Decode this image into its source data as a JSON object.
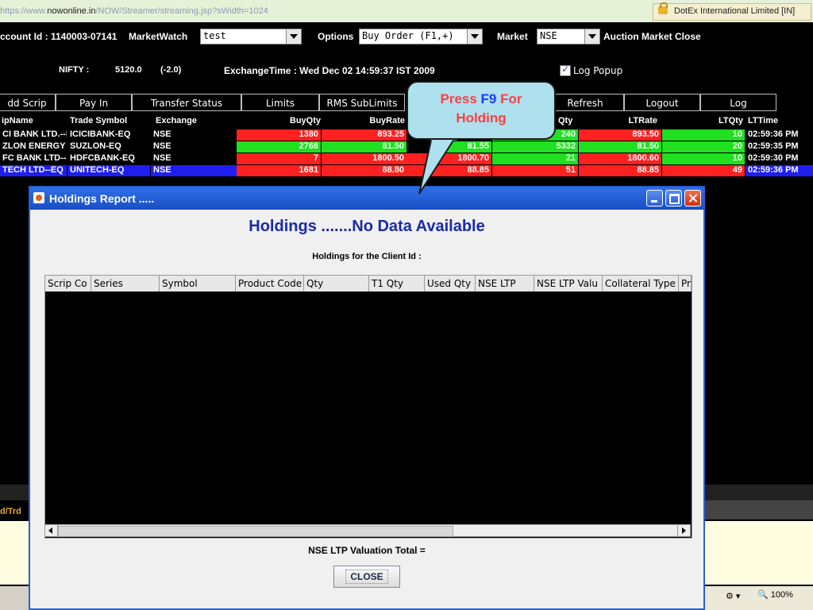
{
  "browser": {
    "url_prefix": "https://www.",
    "url_domain": "nowonline.in",
    "url_path": "/NOW/Streamer/streaming.jsp?sWidth=1024",
    "cert_label": "DotEx International Limited [IN]",
    "zoom_level": "100%"
  },
  "header": {
    "account_label": "ccount Id : 1140003-07141",
    "marketwatch_label": "MarketWatch",
    "marketwatch_value": "test",
    "options_label": "Options",
    "options_value": "Buy Order    (F1,+)",
    "market_label": "Market",
    "market_value": "NSE",
    "auction_label": "Auction Market Close",
    "nifty_label": "NIFTY :",
    "nifty_value": "5120.0",
    "nifty_change": "(-2.0)",
    "exchange_time": "ExchangeTime : Wed Dec 02 14:59:37 IST 2009",
    "log_popup_label": "Log Popup"
  },
  "toolbar": {
    "add_scrip": "dd Scrip",
    "pay_in": "Pay In",
    "transfer_status": "Transfer Status",
    "limits": "Limits",
    "rms_sublimits": "RMS SubLimits",
    "refresh": "Refresh",
    "logout": "Logout",
    "log": "Log"
  },
  "marketwatch": {
    "columns": {
      "scrip_name": "ipName",
      "trade_symbol": "Trade Symbol",
      "exchange": "Exchange",
      "buy_qty": "BuyQty",
      "buy_rate": "BuyRate",
      "qty": "Qty",
      "lt_rate": "LTRate",
      "lt_qty": "LTQty",
      "lt_time": "LTTime"
    },
    "rows": [
      {
        "name": "CI BANK LTD.--E",
        "symbol": "ICICIBANK-EQ",
        "exchange": "NSE",
        "buy_qty": "1380",
        "buy_rate": "893.25",
        "sell_rate": "",
        "sell_qty": "240",
        "lt_rate": "893.50",
        "lt_qty": "10",
        "lt_time": "02:59:36 PM"
      },
      {
        "name": "ZLON ENERGY L",
        "symbol": "SUZLON-EQ",
        "exchange": "NSE",
        "buy_qty": "2768",
        "buy_rate": "81.50",
        "sell_rate": "81.55",
        "sell_qty": "5332",
        "lt_rate": "81.50",
        "lt_qty": "20",
        "lt_time": "02:59:35 PM"
      },
      {
        "name": "FC BANK LTD--E",
        "symbol": "HDFCBANK-EQ",
        "exchange": "NSE",
        "buy_qty": "7",
        "buy_rate": "1800.50",
        "sell_rate": "1800.70",
        "sell_qty": "21",
        "lt_rate": "1800.60",
        "lt_qty": "10",
        "lt_time": "02:59:30 PM"
      },
      {
        "name": "TECH LTD--EQ",
        "symbol": "UNITECH-EQ",
        "exchange": "NSE",
        "buy_qty": "1681",
        "buy_rate": "88.80",
        "sell_rate": "88.85",
        "sell_qty": "51",
        "lt_rate": "88.85",
        "lt_qty": "49",
        "lt_time": "02:59:36 PM"
      }
    ]
  },
  "callout": {
    "press": "Press",
    "key": "F9",
    "for": "For",
    "line2": "Holding"
  },
  "dialog": {
    "title": "Holdings Report .....",
    "heading": "Holdings .......No Data Available",
    "subheading": "Holdings for the Client Id  :",
    "columns": [
      "Scrip Co",
      "Series",
      "Symbol",
      "Product Code",
      "Qty",
      "T1 Qty",
      "Used Qty",
      "NSE LTP",
      "NSE LTP Valu",
      "Collateral Type",
      "Pr"
    ],
    "valuation_label": "NSE LTP Valuation Total =",
    "close_label": "CLOSE"
  },
  "status": {
    "left_label": "d/Trd"
  },
  "colors": {
    "buy_red": "#ff2020",
    "sell_green": "#20e020",
    "highlight_blue": "#1e1ef0",
    "dialog_heading": "#1a2aa8",
    "callout_bg": "#aee0ee"
  }
}
